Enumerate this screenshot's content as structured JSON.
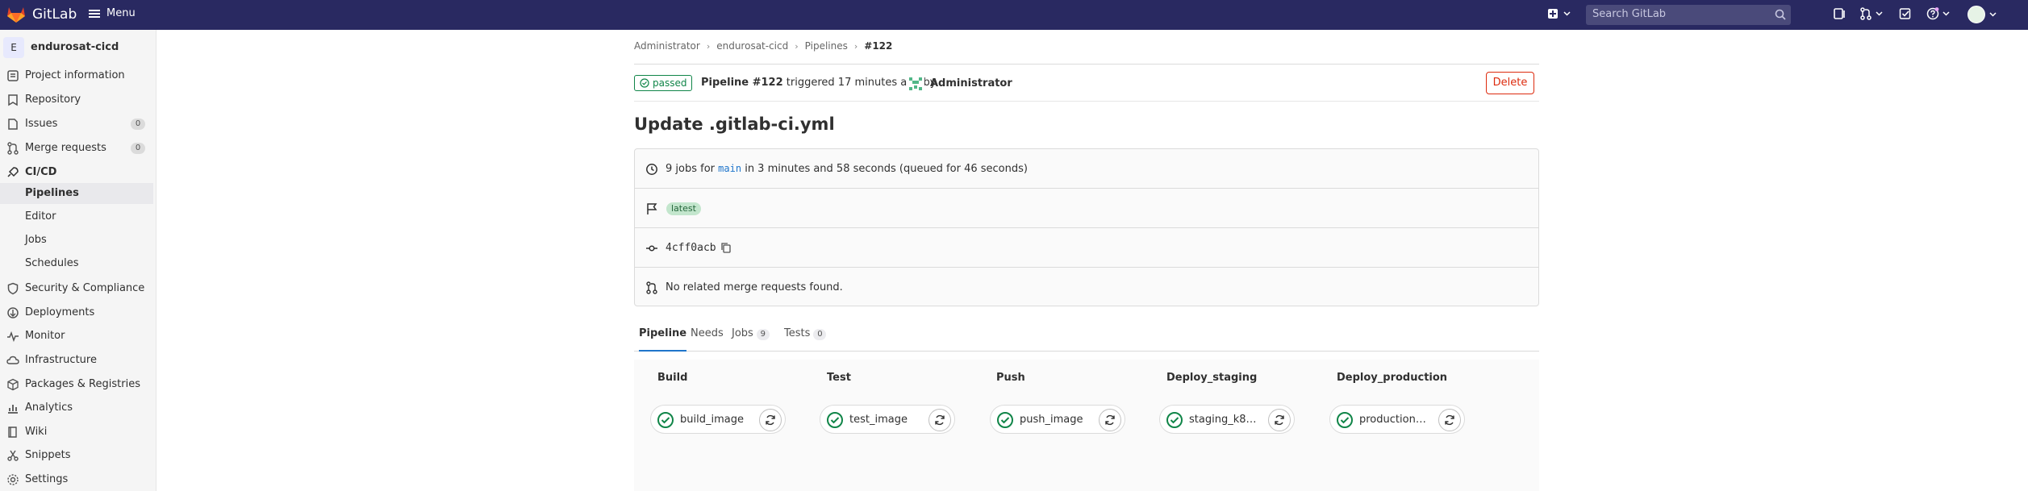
{
  "topbar": {
    "brand": "GitLab",
    "menu_label": "Menu",
    "search_placeholder": "Search GitLab"
  },
  "sidebar": {
    "project_initial": "E",
    "project_name": "endurosat-cicd",
    "items": [
      {
        "label": "Project information",
        "icon": "project-info-icon"
      },
      {
        "label": "Repository",
        "icon": "repository-icon"
      },
      {
        "label": "Issues",
        "icon": "issues-icon",
        "count": "0"
      },
      {
        "label": "Merge requests",
        "icon": "merge-request-icon",
        "count": "0"
      },
      {
        "label": "CI/CD",
        "icon": "rocket-icon"
      },
      {
        "label": "Security & Compliance",
        "icon": "shield-icon"
      },
      {
        "label": "Deployments",
        "icon": "deployments-icon"
      },
      {
        "label": "Monitor",
        "icon": "monitor-icon"
      },
      {
        "label": "Infrastructure",
        "icon": "cloud-icon"
      },
      {
        "label": "Packages & Registries",
        "icon": "package-icon"
      },
      {
        "label": "Analytics",
        "icon": "chart-icon"
      },
      {
        "label": "Wiki",
        "icon": "book-icon"
      },
      {
        "label": "Snippets",
        "icon": "snippet-icon"
      },
      {
        "label": "Settings",
        "icon": "gear-icon"
      }
    ],
    "cicd_sub": [
      "Pipelines",
      "Editor",
      "Jobs",
      "Schedules"
    ]
  },
  "breadcrumb": [
    "Administrator",
    "endurosat-cicd",
    "Pipelines",
    "#122"
  ],
  "pipeline": {
    "status": "passed",
    "name": "Pipeline #122",
    "triggered_text": "triggered 17 minutes ago by",
    "user": "Administrator",
    "delete_label": "Delete",
    "title": "Update .gitlab-ci.yml",
    "jobs_prefix": "9 jobs for",
    "branch": "main",
    "duration_text": "in 3 minutes and 58 seconds (queued for 46 seconds)",
    "tag": "latest",
    "commit": "4cff0acb",
    "mr_text": "No related merge requests found."
  },
  "tabs": [
    {
      "label": "Pipeline",
      "count": null
    },
    {
      "label": "Needs",
      "count": null
    },
    {
      "label": "Jobs",
      "count": "9"
    },
    {
      "label": "Tests",
      "count": "0"
    }
  ],
  "stages": [
    {
      "name": "Build",
      "job": "build_image"
    },
    {
      "name": "Test",
      "job": "test_image"
    },
    {
      "name": "Push",
      "job": "push_image"
    },
    {
      "name": "Deploy_staging",
      "job": "staging_k8s..."
    },
    {
      "name": "Deploy_production",
      "job": "production_k..."
    }
  ],
  "colors": {
    "navbar": "#292961",
    "success": "#108548",
    "danger": "#dd2b0e",
    "link": "#1f75cb"
  }
}
